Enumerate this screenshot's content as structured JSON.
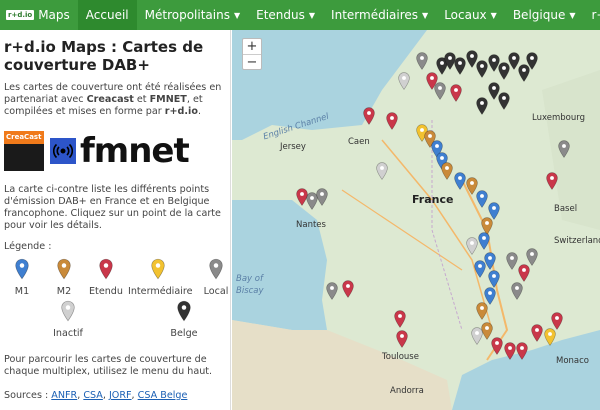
{
  "navbar": {
    "brand_logo": "r+d.io",
    "brand": "Maps",
    "items": [
      {
        "label": "Accueil",
        "active": true,
        "dropdown": false
      },
      {
        "label": "Métropolitains",
        "dropdown": true
      },
      {
        "label": "Etendus",
        "dropdown": true
      },
      {
        "label": "Intermédiaires",
        "dropdown": true
      },
      {
        "label": "Locaux",
        "dropdown": true
      },
      {
        "label": "Belgique",
        "dropdown": true
      },
      {
        "label": "r+d.io",
        "dropdown": false
      }
    ]
  },
  "sidebar": {
    "title": "r+d.io Maps : Cartes de couverture DAB+",
    "intro_1": "Les cartes de couverture ont été réalisées en partenariat avec ",
    "intro_creacast": "Creacast",
    "intro_2": " et ",
    "intro_fmnet": "FMNET",
    "intro_3": ", et compilées et mises en forme par ",
    "intro_rdio": "r+d.io",
    "intro_4": ".",
    "logo_creacast": "CreaCast",
    "logo_fmnet": "fmnet",
    "description": "La carte ci-contre liste les différents points d'émission DAB+ en France et en Belgique francophone. Cliquez sur un point de la carte pour voir les détails.",
    "legend_title": "Légende :",
    "legend": [
      {
        "label": "M1",
        "color": "#3f7fd0"
      },
      {
        "label": "M2",
        "color": "#c98a3a"
      },
      {
        "label": "Etendu",
        "color": "#c9374a"
      },
      {
        "label": "Intermédiaire",
        "color": "#f2c230"
      },
      {
        "label": "Local",
        "color": "#8a8a8a"
      },
      {
        "label": "Inactif",
        "color": "#d0d0d0"
      },
      {
        "label": "Belge",
        "color": "#333333"
      }
    ],
    "footer": "Pour parcourir les cartes de couverture de chaque multiplex, utilisez le menu du haut.",
    "sources_label": "Sources : ",
    "sources": [
      "ANFR",
      "CSA",
      "JORF",
      "CSA Belge"
    ]
  },
  "map": {
    "zoom_in": "+",
    "zoom_out": "−",
    "labels": [
      {
        "text": "English Channel",
        "kind": "water"
      },
      {
        "text": "Bay of",
        "kind": "water"
      },
      {
        "text": "Biscay",
        "kind": "water"
      },
      {
        "text": "France",
        "kind": "big"
      },
      {
        "text": "Luxembourg",
        "kind": "place"
      },
      {
        "text": "Switzerland",
        "kind": "place"
      },
      {
        "text": "Jersey",
        "kind": "place"
      },
      {
        "text": "Caen",
        "kind": "place"
      },
      {
        "text": "Nantes",
        "kind": "place"
      },
      {
        "text": "Basel",
        "kind": "place"
      },
      {
        "text": "Toulouse",
        "kind": "place"
      },
      {
        "text": "Andorra",
        "kind": "place"
      },
      {
        "text": "Monaco",
        "kind": "place"
      }
    ],
    "marker_colors": {
      "m1": "#3f7fd0",
      "m2": "#c98a3a",
      "etendu": "#c9374a",
      "inter": "#f2c230",
      "local": "#8a8a8a",
      "inactif": "#d0d0d0",
      "belge": "#333333"
    }
  }
}
